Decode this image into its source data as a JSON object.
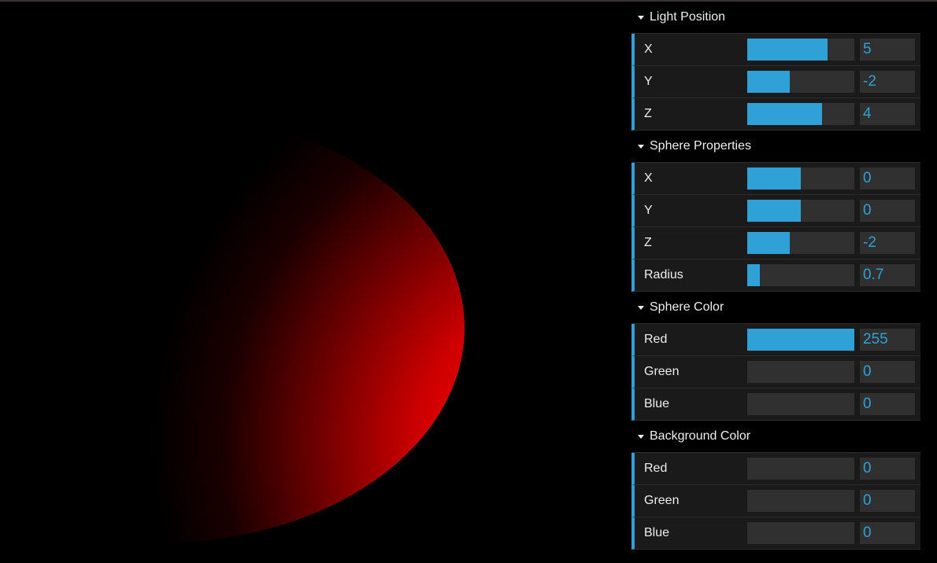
{
  "canvas": {
    "description_icon": "red-crescent-sphere"
  },
  "folders": [
    {
      "title": "Light Position",
      "controls": [
        {
          "label": "X",
          "value": "5",
          "fill": 0.75
        },
        {
          "label": "Y",
          "value": "-2",
          "fill": 0.4
        },
        {
          "label": "Z",
          "value": "4",
          "fill": 0.7
        }
      ]
    },
    {
      "title": "Sphere Properties",
      "controls": [
        {
          "label": "X",
          "value": "0",
          "fill": 0.5
        },
        {
          "label": "Y",
          "value": "0",
          "fill": 0.5
        },
        {
          "label": "Z",
          "value": "-2",
          "fill": 0.4
        },
        {
          "label": "Radius",
          "value": "0.7",
          "fill": 0.12
        }
      ]
    },
    {
      "title": "Sphere Color",
      "controls": [
        {
          "label": "Red",
          "value": "255",
          "fill": 1.0
        },
        {
          "label": "Green",
          "value": "0",
          "fill": 0.0
        },
        {
          "label": "Blue",
          "value": "0",
          "fill": 0.0
        }
      ]
    },
    {
      "title": "Background Color",
      "controls": [
        {
          "label": "Red",
          "value": "0",
          "fill": 0.0
        },
        {
          "label": "Green",
          "value": "0",
          "fill": 0.0
        },
        {
          "label": "Blue",
          "value": "0",
          "fill": 0.0
        }
      ]
    }
  ],
  "colors": {
    "accent": "#2fa1d6",
    "sphere": "#ff0000",
    "background": "#000000"
  }
}
